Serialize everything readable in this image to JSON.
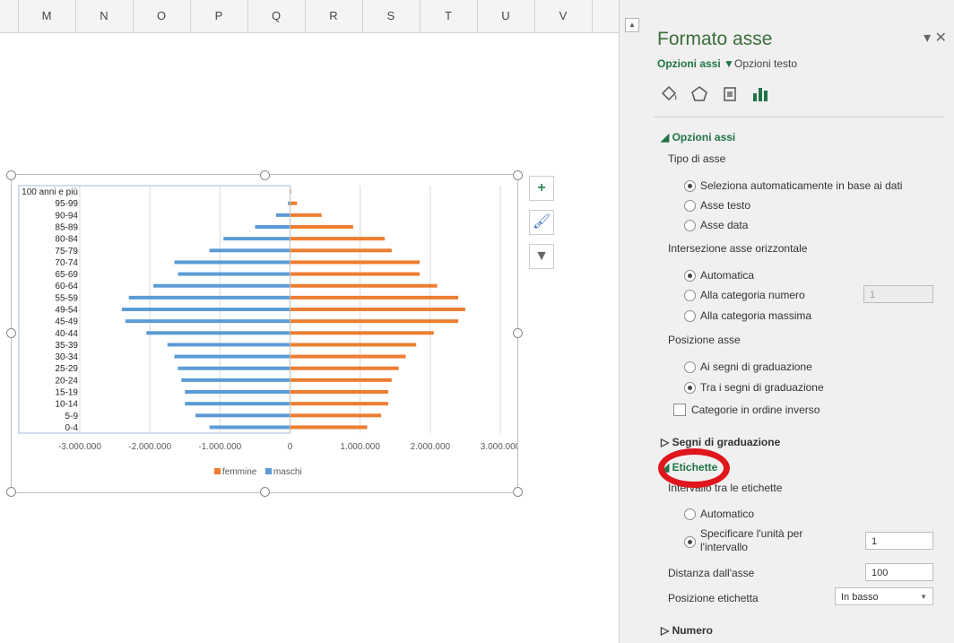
{
  "columns": [
    "M",
    "N",
    "O",
    "P",
    "Q",
    "R",
    "S",
    "T",
    "U",
    "V"
  ],
  "chart_data": {
    "type": "bar",
    "orientation": "horizontal",
    "categories": [
      "0-4",
      "5-9",
      "10-14",
      "15-19",
      "20-24",
      "25-29",
      "30-34",
      "35-39",
      "40-44",
      "45-49",
      "49-54",
      "55-59",
      "60-64",
      "65-69",
      "70-74",
      "75-79",
      "80-84",
      "85-89",
      "90-94",
      "95-99",
      "100 anni e più"
    ],
    "series": [
      {
        "name": "femmine",
        "color": "#ed7d31",
        "values": [
          1100000,
          1300000,
          1400000,
          1400000,
          1450000,
          1550000,
          1650000,
          1800000,
          2050000,
          2400000,
          2500000,
          2400000,
          2100000,
          1850000,
          1850000,
          1450000,
          1350000,
          900000,
          450000,
          100000,
          15000
        ]
      },
      {
        "name": "maschi",
        "color": "#5b9bd5",
        "values": [
          -1150000,
          -1350000,
          -1500000,
          -1500000,
          -1550000,
          -1600000,
          -1650000,
          -1750000,
          -2050000,
          -2350000,
          -2400000,
          -2300000,
          -1950000,
          -1600000,
          -1650000,
          -1150000,
          -950000,
          -500000,
          -200000,
          -30000,
          -5000
        ]
      }
    ],
    "xticks": [
      "-3.000.000",
      "-2.000.000",
      "-1.000.000",
      "0",
      "1.000.000",
      "2.000.000",
      "3.000.000"
    ],
    "xlim": [
      -3000000,
      3000000
    ],
    "grid": true,
    "legend": "bottom"
  },
  "chart_tools": {
    "add": "+",
    "brush": "🖌",
    "filter": "▼"
  },
  "pane": {
    "title": "Formato asse",
    "tab_axis": "Opzioni assi ▼",
    "tab_text": "Opzioni testo",
    "controls": "▾ ✕",
    "icons": [
      "fill-icon",
      "pentagon-icon",
      "size-icon",
      "bar-chart-icon"
    ],
    "section_axis": "◢ Opzioni assi",
    "tipo_asse": "Tipo di asse",
    "r_auto_base": "Seleziona automaticamente in base ai dati",
    "r_asse_testo": "Asse testo",
    "r_asse_data": "Asse data",
    "intersezione": "Intersezione asse orizzontale",
    "r_automatica": "Automatica",
    "r_alla_cat_num": "Alla categoria numero",
    "cat_num_value": "1",
    "r_alla_cat_max": "Alla categoria massima",
    "posizione_asse": "Posizione asse",
    "r_ai_segni": "Ai segni di graduazione",
    "r_tra_segni": "Tra i segni di graduazione",
    "chk_ordine_inverso": "Categorie in ordine inverso",
    "section_segni": "▷ Segni di graduazione",
    "section_etichette": "◢ Etichette",
    "intervallo": "Intervallo tra le etichette",
    "r_automatico": "Automatico",
    "r_specificare": "Specificare l'unità per l'intervallo",
    "specificare_value": "1",
    "distanza": "Distanza dall'asse",
    "distanza_value": "100",
    "posizione_etichetta": "Posizione etichetta",
    "posizione_value": "In basso",
    "section_numero": "▷ Numero"
  },
  "colors": {
    "accent": "#217346",
    "annotation": "#e0161d"
  }
}
